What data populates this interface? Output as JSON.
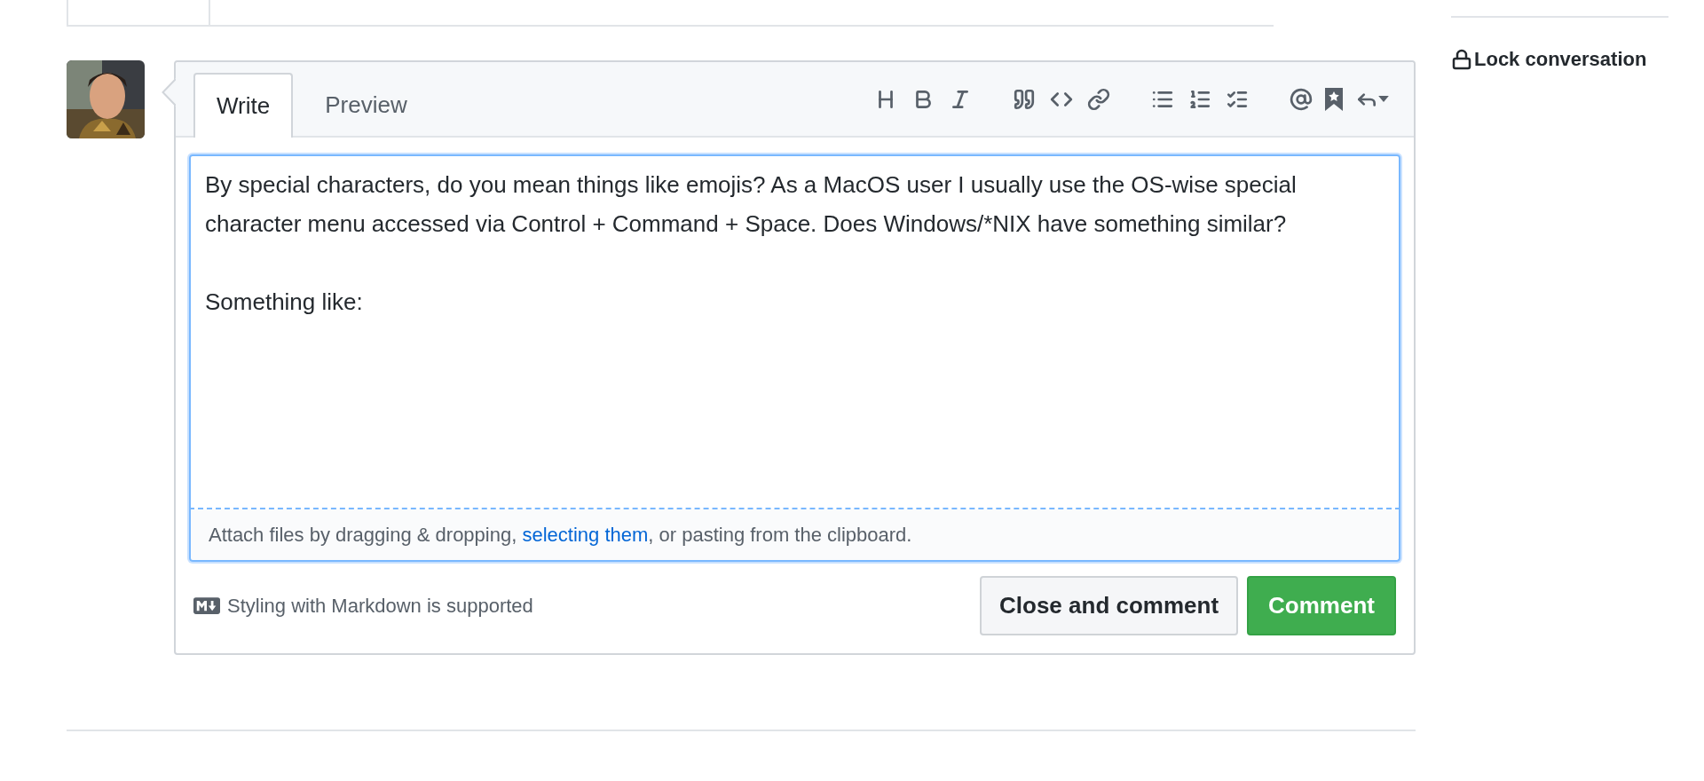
{
  "sidebar": {
    "lock_link": "Lock conversation"
  },
  "editor": {
    "tabs": [
      {
        "label": "Write",
        "selected": true
      },
      {
        "label": "Preview",
        "selected": false
      }
    ],
    "body": "By special characters, do you mean things like emojis? As a MacOS user I usually use the OS-wise special character menu accessed via Control + Command + Space. Does Windows/*NIX have something similar?\n\nSomething like:\n\n",
    "attach": {
      "before": "Attach files by dragging & dropping, ",
      "link": "selecting them",
      "after": ", or pasting from the clipboard."
    },
    "markdown_note": "Styling with Markdown is supported",
    "buttons": [
      {
        "kind": "secondary",
        "label": "Close and comment"
      },
      {
        "kind": "primary",
        "label": "Comment"
      }
    ]
  }
}
